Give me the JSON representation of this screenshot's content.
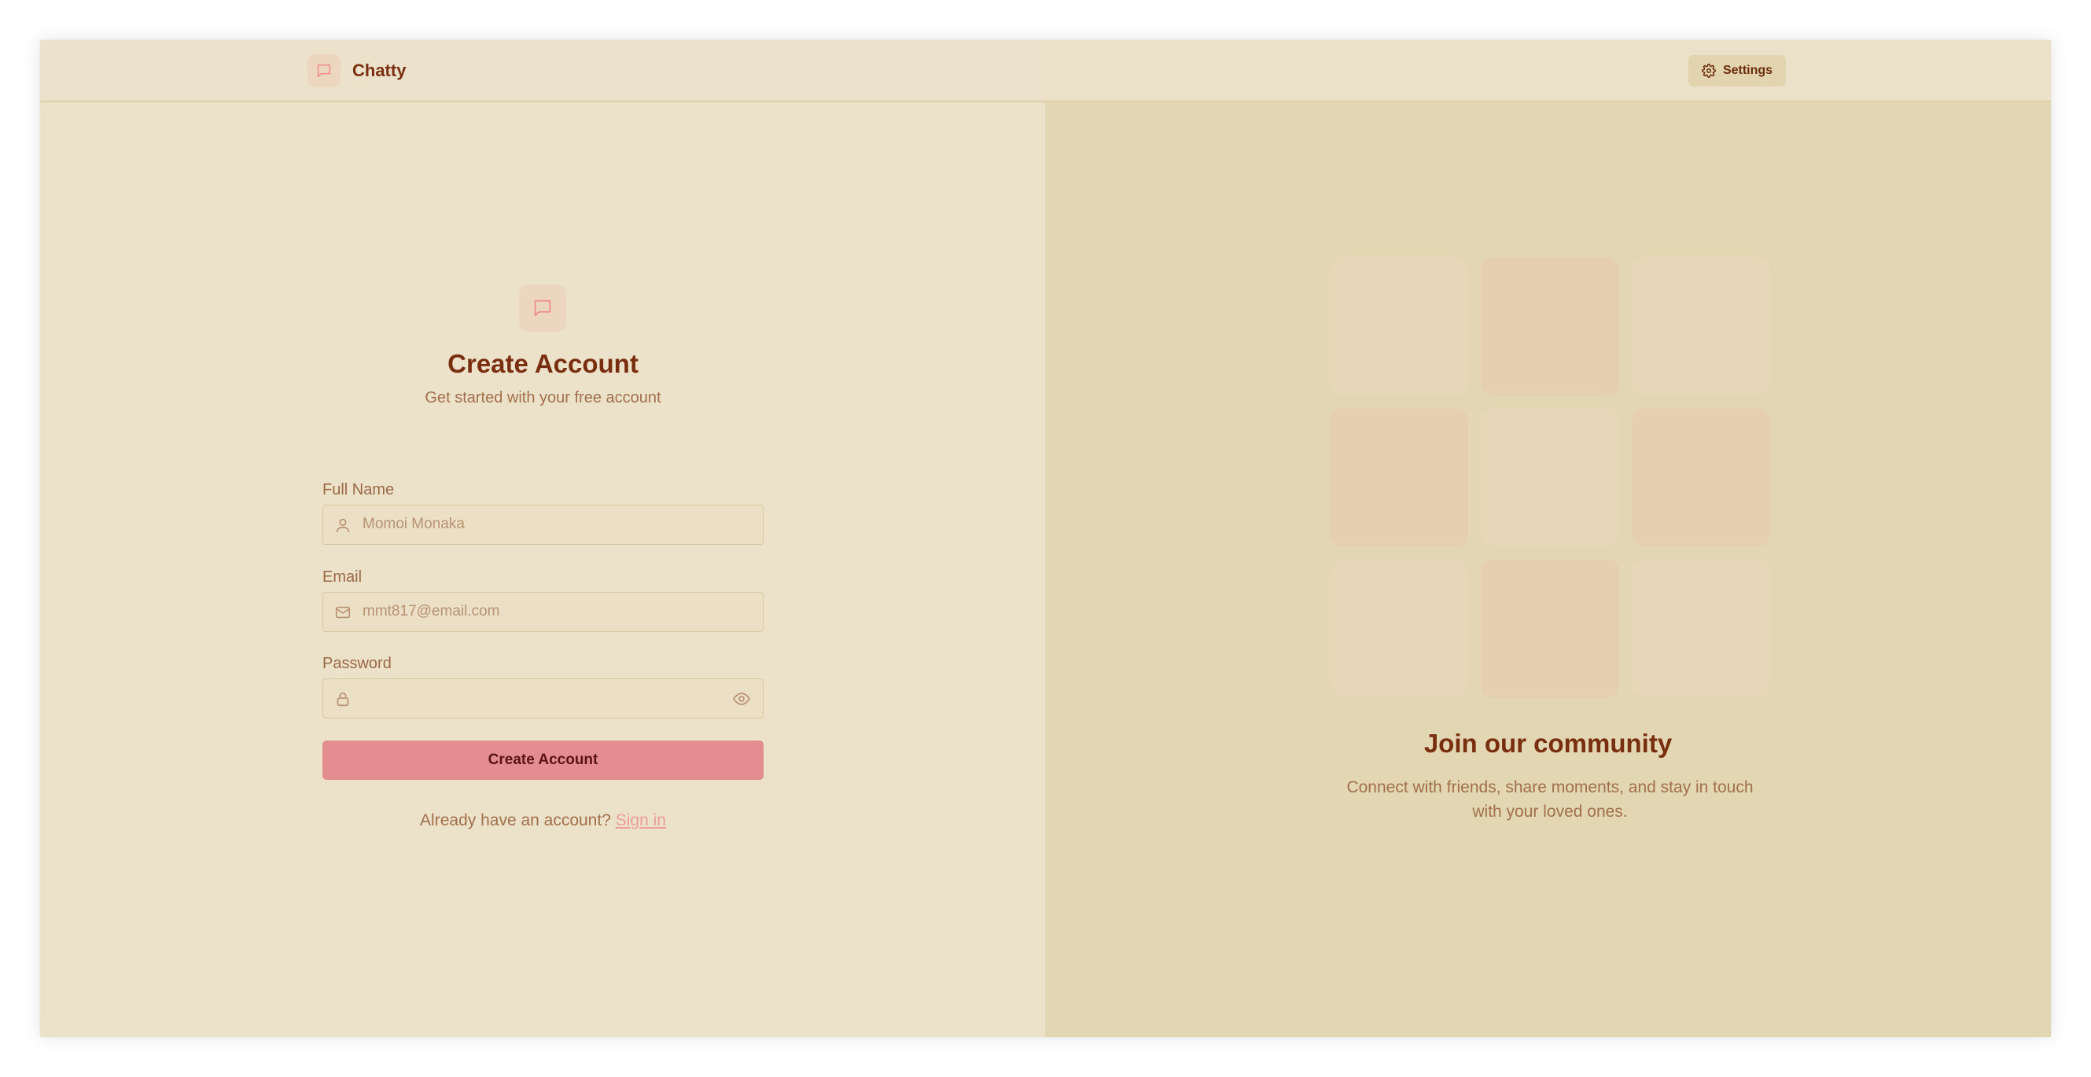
{
  "app": {
    "name": "Chatty",
    "brand_icon": "chat-bubble-icon"
  },
  "navbar": {
    "settings_label": "Settings",
    "settings_icon": "gear-icon"
  },
  "form": {
    "icon": "chat-bubble-icon",
    "title": "Create Account",
    "subtitle": "Get started with your free account",
    "fields": {
      "full_name": {
        "label": "Full Name",
        "placeholder": "Momoi Monaka",
        "value": "",
        "icon": "user-icon"
      },
      "email": {
        "label": "Email",
        "placeholder": "mmt817@email.com",
        "value": "",
        "icon": "mail-icon"
      },
      "password": {
        "label": "Password",
        "placeholder": "",
        "value": "",
        "icon": "lock-icon",
        "toggle_icon": "eye-icon"
      }
    },
    "submit_label": "Create Account",
    "signin_prompt": "Already have an account?",
    "signin_link": "Sign in"
  },
  "community": {
    "title": "Join our community",
    "description": "Connect with friends, share moments, and stay in touch with your loved ones.",
    "tile_pattern": [
      "plain",
      "pink",
      "plain",
      "pink",
      "plain",
      "pink",
      "plain",
      "pink",
      "plain"
    ]
  },
  "colors": {
    "background": "#ece1c9",
    "right_panel": "#e3d6b2",
    "primary": "#e48d91",
    "heading": "#7a2e10",
    "muted_text": "#a2704c",
    "link": "#ec9c9d"
  }
}
